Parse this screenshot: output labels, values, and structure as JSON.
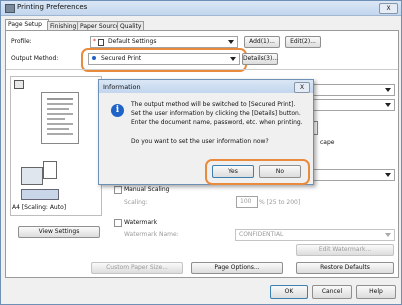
{
  "window": {
    "title": "Printing Preferences",
    "close_label": "X"
  },
  "tabs": [
    {
      "label": "Page Setup"
    },
    {
      "label": "Finishing"
    },
    {
      "label": "Paper Source"
    },
    {
      "label": "Quality"
    }
  ],
  "profile": {
    "label": "Profile:",
    "value": "Default Settings",
    "add_button": "Add(1)...",
    "edit_button": "Edit(2)..."
  },
  "output": {
    "label": "Output Method:",
    "value": "Secured Print",
    "details_button": "Details(3)..."
  },
  "preview": {
    "caption": "A4 [Scaling: Auto]",
    "view_settings_button": "View Settings"
  },
  "orientation": {
    "landscape_label": "cape"
  },
  "manual_scaling": {
    "label": "Manual Scaling",
    "scaling_label": "Scaling:",
    "value": "100",
    "range": "% [25 to 200]"
  },
  "watermark": {
    "label": "Watermark",
    "name_label": "Watermark Name:",
    "value": "CONFIDENTIAL",
    "edit_button": "Edit Watermark..."
  },
  "bottom": {
    "custom_paper_button": "Custom Paper Size...",
    "page_options_button": "Page Options...",
    "restore_button": "Restore Defaults"
  },
  "footer": {
    "ok": "OK",
    "cancel": "Cancel",
    "help": "Help"
  },
  "dialog": {
    "title": "Information",
    "close_label": "X",
    "message_lines": [
      "The output method will be switched to [Secured Print].",
      "Set the user information by clicking the [Details] button.",
      "Enter the document name, password, etc. when printing."
    ],
    "question": "Do you want to set the user information now?",
    "yes": "Yes",
    "no": "No"
  },
  "colors": {
    "highlight": "#e98b3d",
    "info_icon": "#1f62c8",
    "title_bar": "#c2d6ee"
  }
}
